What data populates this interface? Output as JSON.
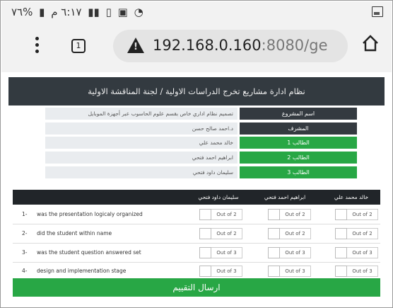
{
  "status_bar": {
    "time": "٦:١٧ م",
    "battery": "%٧٦",
    "icons": [
      "battery-icon",
      "signal-icon",
      "data-icon",
      "wifi-icon",
      "image-icon"
    ]
  },
  "browser": {
    "tab_count": "1",
    "url_main": "192.168.0.160",
    "url_rest": ":8080/ge"
  },
  "page": {
    "header_title": "نظام ادارة مشاريع تخرج الدراسات الاولية / لجنة المناقشة الاولية",
    "info_rows": [
      {
        "label": "اسم المشروع",
        "value": "تصميم نظام اداري خاص بقسم علوم الحاسوب عبر أجهزة الموبايل",
        "style": "dark"
      },
      {
        "label": "المشرف",
        "value": "د.احمد صالح حسن",
        "style": "dark"
      },
      {
        "label": "الطالب 1",
        "value": "خالد محمد علي",
        "style": "green"
      },
      {
        "label": "الطالب 2",
        "value": "ابراهيم احمد فتحي",
        "style": "green"
      },
      {
        "label": "الطالب 3",
        "value": "سليمان داود فتحي",
        "style": "green"
      }
    ],
    "table": {
      "headers": [
        "خالد محمد علي",
        "ابراهيم احمد فتحي",
        "سليمان داود فتحي"
      ],
      "rows": [
        {
          "num": "1-",
          "question": "was the presentation logicaly organized",
          "out": "Out of 2"
        },
        {
          "num": "2-",
          "question": "did the student within name",
          "out": "Out of 2"
        },
        {
          "num": "3-",
          "question": "was the student question answered set",
          "out": "Out of 3"
        },
        {
          "num": "4-",
          "question": "design and implementation stage",
          "out": "Out of 3"
        }
      ]
    },
    "submit_label": "ارسال التقييم"
  },
  "colors": {
    "header_bg": "#333a40",
    "dark_label": "#343a40",
    "green": "#28a745",
    "table_head": "#212529"
  }
}
